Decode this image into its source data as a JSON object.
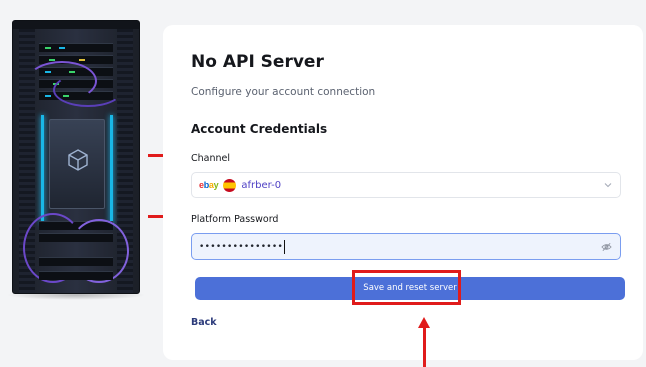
{
  "page": {
    "title": "No API Server",
    "subtitle": "Configure your account connection",
    "section_heading": "Account Credentials"
  },
  "channel": {
    "label": "Channel",
    "marketplace_logo": "ebay",
    "flag": "spain-flag",
    "value": "afrber-0"
  },
  "password": {
    "label": "Platform Password",
    "value": "•••••••••••••••"
  },
  "actions": {
    "save_label": "Save and reset server",
    "back_label": "Back"
  },
  "colors": {
    "primary_button": "#4c70d8",
    "annotation_red": "#e01b1b",
    "input_focus_border": "#7a9df0",
    "card_background": "#ffffff",
    "page_background": "#f3f4f6"
  },
  "icons": [
    "server-rack-illustration",
    "chevron-down-icon",
    "eye-off-icon"
  ]
}
